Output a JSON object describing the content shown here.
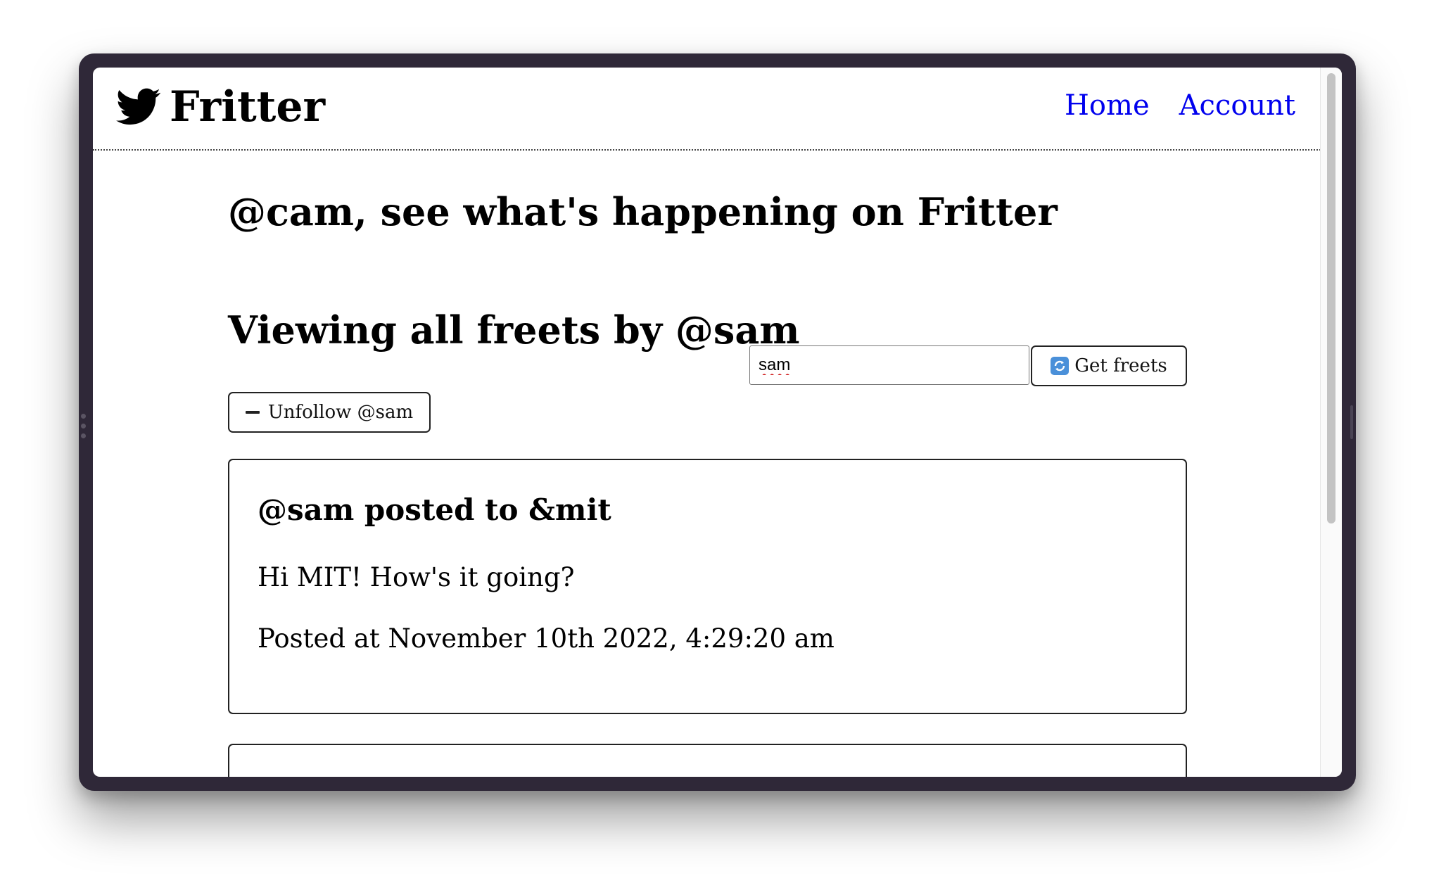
{
  "header": {
    "brand": "Fritter",
    "nav": [
      {
        "label": "Home"
      },
      {
        "label": "Account"
      }
    ]
  },
  "main": {
    "welcome": "@cam, see what's happening on Fritter",
    "viewing_title": "Viewing all freets by @sam",
    "search": {
      "value": "sam"
    },
    "get_freets_label": "Get freets",
    "unfollow_label": "Unfollow @sam",
    "freets": [
      {
        "title": "@sam posted to &mit",
        "content": "Hi MIT! How's it going?",
        "date": "Posted at November 10th 2022, 4:29:20 am"
      }
    ]
  },
  "icons": [
    "bird-logo-icon",
    "refresh-icon",
    "minus-icon"
  ]
}
